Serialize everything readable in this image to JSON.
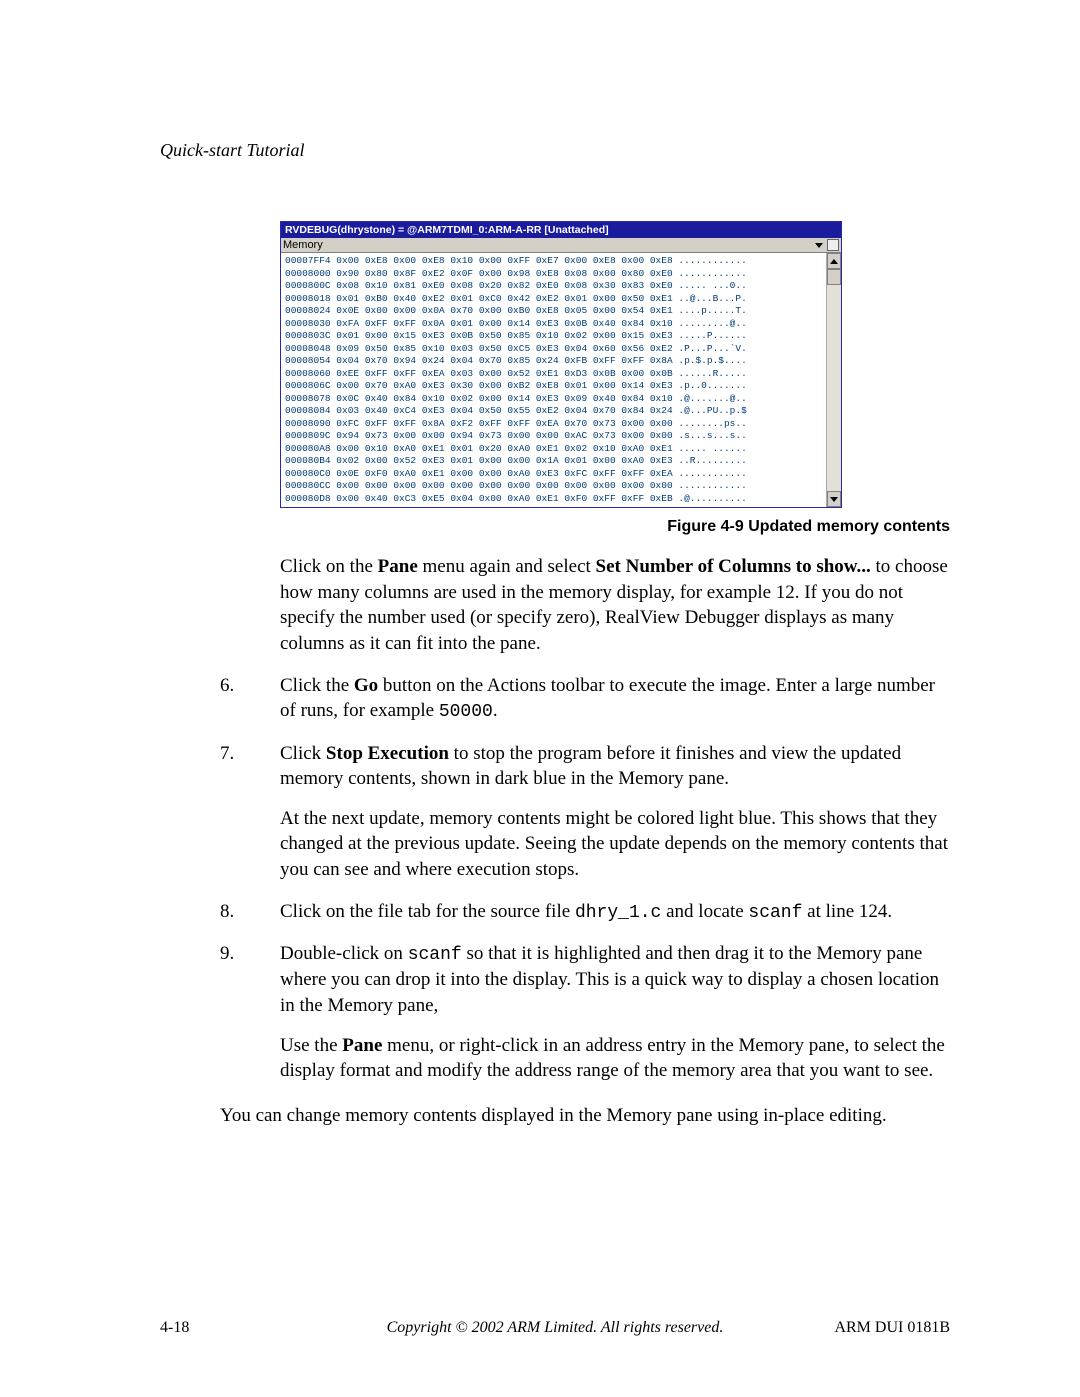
{
  "running_head": "Quick-start Tutorial",
  "memwin": {
    "title": "RVDEBUG(dhrystone) = @ARM7TDMI_0:ARM-A-RR [Unattached]",
    "toolbar_label": "Memory",
    "hex_rows": [
      "00007FF4 0x00 0xE8 0x00 0xE8 0x10 0x00 0xFF 0xE7 0x00 0xE8 0x00 0xE8 ............",
      "00008000 0x90 0x80 0x8F 0xE2 0x0F 0x00 0x98 0xE8 0x08 0x00 0x80 0xE0 ............",
      "0000800C 0x08 0x10 0x81 0xE0 0x08 0x20 0x82 0xE0 0x08 0x30 0x83 0xE0 ..... ...0..",
      "00008018 0x01 0xB0 0x40 0xE2 0x01 0xC0 0x42 0xE2 0x01 0x00 0x50 0xE1 ..@...B...P.",
      "00008024 0x0E 0x00 0x00 0x0A 0x70 0x00 0xB0 0xE8 0x05 0x00 0x54 0xE1 ....p.....T.",
      "00008030 0xFA 0xFF 0xFF 0x0A 0x01 0x00 0x14 0xE3 0x0B 0x40 0x84 0x10 .........@..",
      "0000803C 0x01 0x00 0x15 0xE3 0x0B 0x50 0x85 0x10 0x02 0x00 0x15 0xE3 .....P......",
      "00008048 0x09 0x50 0x85 0x10 0x03 0x50 0xC5 0xE3 0x04 0x60 0x56 0xE2 .P...P...`V.",
      "00008054 0x04 0x70 0x94 0x24 0x04 0x70 0x85 0x24 0xFB 0xFF 0xFF 0x8A .p.$.p.$....",
      "00008060 0xEE 0xFF 0xFF 0xEA 0x03 0x00 0x52 0xE1 0xD3 0x0B 0x00 0x0B ......R.....",
      "0000806C 0x00 0x70 0xA0 0xE3 0x30 0x00 0xB2 0xE8 0x01 0x00 0x14 0xE3 .p..0.......",
      "00008078 0x0C 0x40 0x84 0x10 0x02 0x00 0x14 0xE3 0x09 0x40 0x84 0x10 .@.......@..",
      "00008084 0x03 0x40 0xC4 0xE3 0x04 0x50 0x55 0xE2 0x04 0x70 0x84 0x24 .@...PU..p.$",
      "00008090 0xFC 0xFF 0xFF 0x8A 0xF2 0xFF 0xFF 0xEA 0x70 0x73 0x00 0x00 ........ps..",
      "0000809C 0x94 0x73 0x00 0x00 0x94 0x73 0x00 0x00 0xAC 0x73 0x00 0x00 .s...s...s..",
      "000080A8 0x00 0x10 0xA0 0xE1 0x01 0x20 0xA0 0xE1 0x02 0x10 0xA0 0xE1 ..... ......",
      "000080B4 0x02 0x00 0x52 0xE3 0x01 0x00 0x00 0x1A 0x01 0x00 0xA0 0xE3 ..R.........",
      "000080C0 0x0E 0xF0 0xA0 0xE1 0x00 0x00 0xA0 0xE3 0xFC 0xFF 0xFF 0xEA ............",
      "000080CC 0x00 0x00 0x00 0x00 0x00 0x00 0x00 0x00 0x00 0x00 0x00 0x00 ............",
      "000080D8 0x00 0x40 0xC3 0xE5 0x04 0x00 0xA0 0xE1 0xF0 0xFF 0xFF 0xEB .@.........."
    ]
  },
  "figure_caption": "Figure 4-9 Updated memory contents",
  "para_after_figure": {
    "t1": "Click on the ",
    "b1": "Pane",
    "t2": " menu again and select ",
    "b2": "Set Number of Columns to show...",
    "t3": " to choose how many columns are used in the memory display, for example 12. If you do not specify the number used (or specify zero), RealView Debugger displays as many columns as it can fit into the pane."
  },
  "steps": {
    "s6": {
      "num": "6.",
      "t1": "Click the ",
      "b1": "Go",
      "t2": " button on the Actions toolbar to execute the image. Enter a large number of runs, for example ",
      "m1": "50000",
      "t3": "."
    },
    "s7": {
      "num": "7.",
      "p1_a": "Click ",
      "p1_b": "Stop Execution",
      "p1_c": " to stop the program before it finishes and view the updated memory contents, shown in dark blue in the Memory pane.",
      "p2": "At the next update, memory contents might be colored light blue. This shows that they changed at the previous update. Seeing the update depends on the memory contents that you can see and where execution stops."
    },
    "s8": {
      "num": "8.",
      "t1": "Click on the file tab for the source file ",
      "m1": "dhry_1.c",
      "t2": " and locate ",
      "m2": "scanf",
      "t3": " at line 124."
    },
    "s9": {
      "num": "9.",
      "p1_a": "Double-click on ",
      "p1_m": "scanf",
      "p1_b": " so that it is highlighted and then drag it to the Memory pane where you can drop it into the display. This is a quick way to display a chosen location in the Memory pane,",
      "p2_a": "Use the ",
      "p2_b": "Pane",
      "p2_c": " menu, or right-click in an address entry in the Memory pane, to select the display format and modify the address range of the memory area that you want to see."
    }
  },
  "closing": "You can change memory contents displayed in the Memory pane using in-place editing.",
  "footer": {
    "left": "4-18",
    "center": "Copyright © 2002 ARM Limited. All rights reserved.",
    "right": "ARM DUI 0181B"
  }
}
